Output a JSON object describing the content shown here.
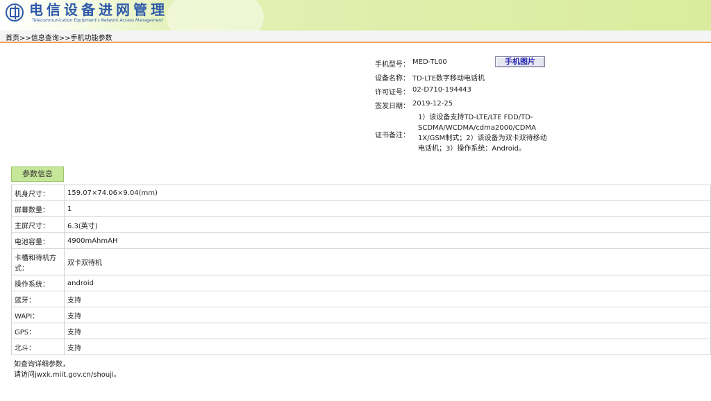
{
  "header": {
    "title": "电信设备进网管理",
    "subtitle": "Telecommunication Equipment's Network Access Management"
  },
  "breadcrumb": "首页>>信息查询>>手机功能参数",
  "device": {
    "model_label": "手机型号：",
    "model": "MED-TL00",
    "name_label": "设备名称：",
    "name": "TD-LTE数字移动电话机",
    "license_label": "许可证号：",
    "license": "02-D710-194443",
    "date_label": "签发日期：",
    "date": "2019-12-25",
    "notes_label": "证书备注：",
    "notes": "1）该设备支持TD-LTE/LTE FDD/TD-SCDMA/WCDMA/cdma2000/CDMA 1X/GSM制式；2）该设备为双卡双待移动电话机；3）操作系统：Android。",
    "photo_button": "手机图片"
  },
  "params": {
    "tab_label": "参数信息",
    "rows": [
      {
        "key": "机身尺寸：",
        "value": "159.07×74.06×9.04(mm)"
      },
      {
        "key": "屏幕数量：",
        "value": "1"
      },
      {
        "key": "主屏尺寸：",
        "value": "6.3(英寸)"
      },
      {
        "key": "电池容量：",
        "value": "4900mAhmAH"
      },
      {
        "key": "卡槽和待机方式：",
        "value": "双卡双待机"
      },
      {
        "key": "操作系统：",
        "value": "android"
      },
      {
        "key": "蓝牙：",
        "value": "支持"
      },
      {
        "key": "WAPI：",
        "value": "支持"
      },
      {
        "key": "GPS：",
        "value": "支持"
      },
      {
        "key": "北斗：",
        "value": "支持"
      }
    ]
  },
  "footer": {
    "line1": "如查询详细参数，",
    "line2": "请访问jwxk.miit.gov.cn/shouji。"
  },
  "colors": {
    "brand_blue": "#2d59a8",
    "banner_green": "#d9ec9d",
    "tab_green": "#c6e69a",
    "breadcrumb_border": "#f0a25a"
  }
}
